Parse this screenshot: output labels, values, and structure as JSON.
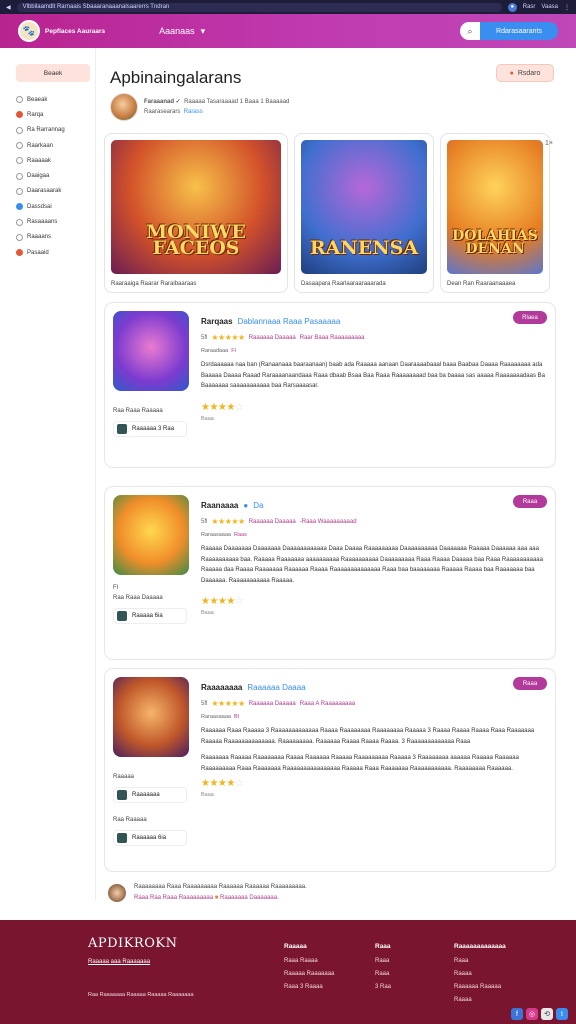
{
  "browser": {
    "url": "Vlbbilaamdlt Rarnaais Sbaaaranaaanalsaarerrs Tndran",
    "icons": [
      "Rasr",
      "Vaasa"
    ]
  },
  "header": {
    "logo": "Pepflaces Aauraars",
    "nav": "Aaanaas",
    "search_button": "Rdarasaarants"
  },
  "sidebar": {
    "button": "Beaek",
    "items": [
      "Beaeak",
      "Rarqa",
      "Ra Rarrannag",
      "Raarkaan",
      "Raaaaak",
      "Daaigaa",
      "Daarasaarak",
      "Dassdsai",
      "Rasaaaans",
      "Raaaans",
      "Pasaaid"
    ]
  },
  "page": {
    "title": "Apbinaingalarans",
    "follow": "Rsdaro",
    "author": {
      "name": "Faraaanad ✓",
      "meta": "Raaaaa   Tasaraaaad 1 Baaa 1 Baaaaad",
      "role": "Raarasearars",
      "badge": "Rarass"
    },
    "close": "1×"
  },
  "gallery": [
    {
      "art": "MONIWE FACEOS",
      "caption": "Raaraaiga Raarar Raraibaaraas"
    },
    {
      "art": "RANENSA",
      "caption": "Dasaapara Raarlaaraaraaarada"
    },
    {
      "art": "DOLAHIAS DENAN",
      "caption": "Dean Ran Raaraanaaaea"
    }
  ],
  "listings": [
    {
      "name": "Rarqaas",
      "name_blue": "Dablannaaa Raaa   Pasaaaaa",
      "rating_num": "5fl",
      "rating_label": "Raaaaaa Daaaaa",
      "rating_extra": "Raar Baaa Raaaaaaaaa",
      "sub": "Raraadaaa",
      "sub_tag": "Fl",
      "desc": "Dsrdaaaaaa naa ban (Ranaanaaa baaraanaan) baab ada Raaaaa aanaan Daaraaaabaaal baaa Baabaa Daaaa Raaaaaaaa ada Baaaaa Daaaa Raaad Raraaaanaandaaa Raaa dbaab Bsaa Baa Raaa Raaaaaaaad baa ba baaaa sas aaaaa Raaaaaaadaas Ba Baaaaaaa saaaaaaaaaaa baa Rarsaaaasar.",
      "left_meta": "Raa Raaa Raaaaa",
      "tag": "Raaaaaa 3 Raa",
      "stars": "4",
      "foot": "Baaa",
      "pill": "Rlaea"
    },
    {
      "name": "Raanaaaa",
      "name_blue": "Da",
      "rating_num": "5fl",
      "rating_label": "Raaaaaa Daaaaa",
      "rating_extra": "-Raaa Waaaaaaaaad",
      "sub": "Raraasaaaa",
      "sub_tag": "Raas",
      "desc": "Raaaaa Daaaaaaa Daaaaaaa Daaaaaaaaaaaa Daaa Daaaa Raaaaaaaaa Daaaaaaaaaa Daaaaaaa Raaaaa Daaaaaa aaa aaa Raaaaaaaaaa baa. Raaaaa Raaaaaaa aaaaaaaaaa Raaaaaaaaaa Daaaaaaaaa Raaa Raaaa Daaaaa baa Raaa Raaaaaaaaaaa Raaaaa daa Raaaa Raaaaaaa Raaaaaa Raaaa Raaaaaaaaaaaaaa Raaa baa baaaaaaaa Raaaaa Raaaa baa Raaaaaaa baa Daaaaaa. Raaaaaaaaaaa Raaaaa.",
      "left_meta": "Raa Raaa Daaaaa",
      "tag": "Raaaaa 6ia",
      "stars": "4",
      "foot": "Baaa",
      "pill": "Raaa"
    },
    {
      "name": "Raaaaaaaa",
      "name_blue": "Raaaaaa Daaaa",
      "rating_num": "5fl",
      "rating_label": "Raaaaaa Daaaaa",
      "rating_extra": "Raaa A Raaaaaaaaa",
      "sub": "Raraasaaaa",
      "sub_tag": "Bl",
      "desc": "Raaaaaa Raaa Raaaaa 3 Raaaaaaaaaaaaa Raaaa Raaaaaaaa Raaaaaaaa Raaaaa 3 Raaaa Raaaa Raaaa Raaa Raaaaaaa Raaaaa Raaaaaaaaaaaaaa. Raaaaaaaaa. Raaaaaa Raaaa Raaaa Raaaa. 3 Raaaaaaaaaaaaa Raaa",
      "desc2": "Raaaaaaa Raaaaa Raaaaaaaa Raaaa Raaaaaa Raaaaa Raaaaaaaaa Raaaaa 3 Raaaaaaaa aaaaaa Raaaaa Raaaaaa Raaaaaaaaa Raaa Raaaaaaa Raaaaaaaaaaaaaaaa Raaaaa Raaa Raaaaaaa Raaaaaaaaaaa. Raaaaaaaa Raaaaaa.",
      "left_meta": "Raaaaa",
      "tag": "Raaaaaaa",
      "left_meta2": "Raa Raaaaa",
      "tag2": "Raaaaaa 6ia",
      "stars": "4",
      "foot": "Baaa",
      "pill": "Raaa"
    }
  ],
  "note": {
    "line1": "Raaaaaaaa Raaa Raaaaaaaaa  Raaaaaa Raaaaaa Raaaaaaaaa.",
    "line2a": "Raaa Raa Raaa Raaaaaaaaa",
    "line2b": "Raaaaaaa Daaaaaaa."
  },
  "footer": {
    "brand": "APDIKROKN",
    "sub": "Raaaaa aaa Raaaaaaa",
    "copy": "Raa Raaaaaaa Raaaaa Raaaaa Raaaaaaa",
    "col1": {
      "h": "Raaaaa",
      "items": [
        "Raaa Raaaa",
        "Raaaaa Raaaaaaa",
        "Raaa 3 Raaaa"
      ]
    },
    "col2": {
      "h": "Raaa",
      "items": [
        "Raaa",
        "Raaa",
        "3 Raa"
      ]
    },
    "col3": {
      "h": "Raaaaaaaaaaaaa",
      "items": [
        "Raaa",
        "Raaaa",
        "Raaaaaa Raaaaa",
        "Raaaa"
      ]
    }
  },
  "colors": {
    "header": "#b8238f",
    "accent": "#3a8ef0",
    "footer": "#7a1530",
    "pill": "#b23a9a"
  }
}
